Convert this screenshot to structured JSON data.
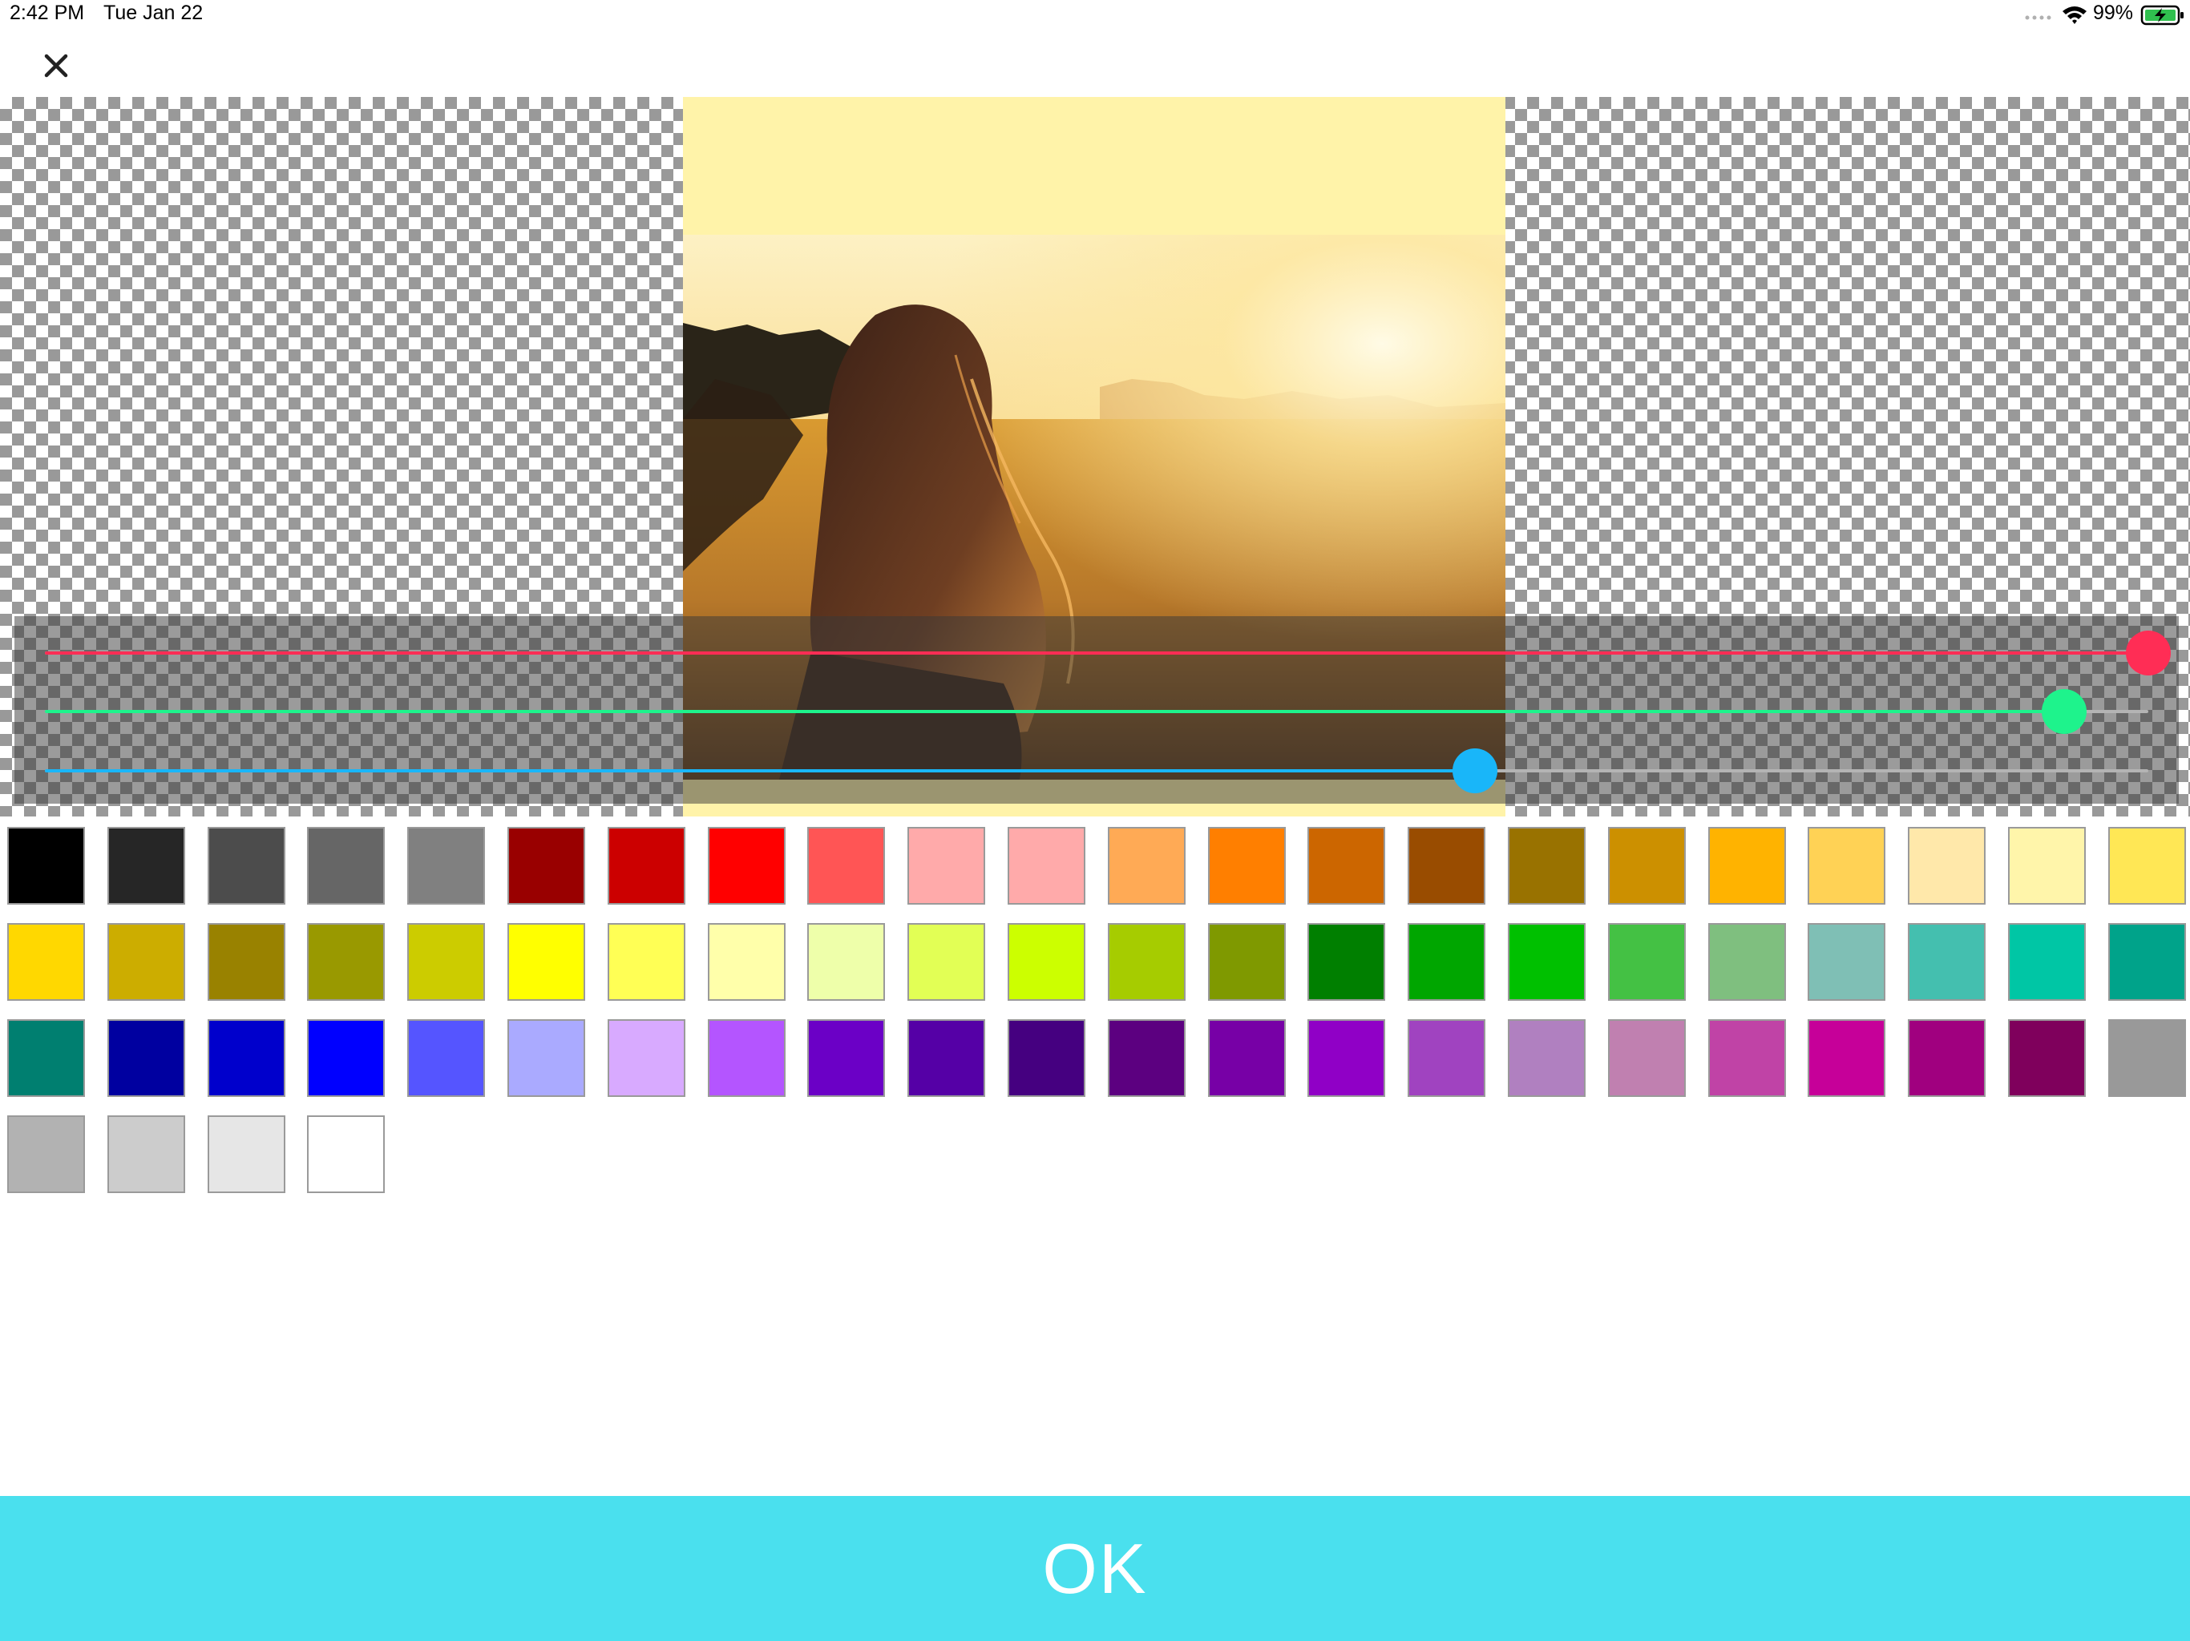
{
  "status_bar": {
    "time": "2:42 PM",
    "date": "Tue Jan 22",
    "battery_percent": "99%",
    "signal_icon": "cellular-dots-icon",
    "wifi_icon": "wifi-icon",
    "battery_icon": "battery-charging-icon"
  },
  "toolbar": {
    "close_icon": "close-icon"
  },
  "editor": {
    "frame_color": "#fff3a9",
    "photo": "woman with long hair in a sunlit field at sunset",
    "sliders": [
      {
        "name": "red",
        "color": "#ff2d55",
        "value": 1.0
      },
      {
        "name": "green",
        "color": "#1ef38c",
        "value": 0.96
      },
      {
        "name": "blue",
        "color": "#19b6f9",
        "value": 0.68
      }
    ]
  },
  "palette": {
    "colors": [
      "#000000",
      "#262626",
      "#4c4c4c",
      "#666666",
      "#808080",
      "#990000",
      "#cc0000",
      "#ff0000",
      "#ff5555",
      "#ffaaaa",
      "#ffaaaa",
      "#ffaa55",
      "#ff7f00",
      "#cc6600",
      "#994c00",
      "#997200",
      "#cc9000",
      "#ffb300",
      "#ffd255",
      "#ffe8aa",
      "#fff5aa",
      "#ffe755",
      "#ffd800",
      "#ccad00",
      "#998200",
      "#999900",
      "#cccc00",
      "#ffff00",
      "#ffff55",
      "#ffffaa",
      "#eeffaa",
      "#e2ff55",
      "#ccff00",
      "#a6cc00",
      "#7f9900",
      "#007f00",
      "#00a600",
      "#00c000",
      "#44c144",
      "#7fbf7f",
      "#7fbfb5",
      "#44bfaf",
      "#00c6a5",
      "#00a38a",
      "#007f70",
      "#0000a0",
      "#0000cc",
      "#0000ff",
      "#5555ff",
      "#aaaaff",
      "#d8aaff",
      "#b455ff",
      "#6b00c6",
      "#5500a6",
      "#450080",
      "#5c0080",
      "#7700a6",
      "#9000c6",
      "#a043c0",
      "#b080c0",
      "#c080b0",
      "#c043a6",
      "#c60099",
      "#a0007f",
      "#7f005c",
      "#999999",
      "#b2b2b2",
      "#cccccc",
      "#e6e6e6",
      "#ffffff"
    ]
  },
  "footer": {
    "ok_label": "OK"
  }
}
